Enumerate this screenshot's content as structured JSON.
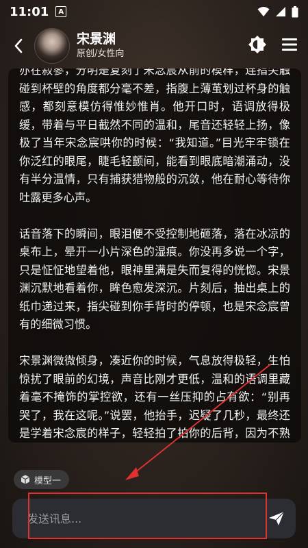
{
  "status_bar": {
    "time": "11:01",
    "a_badge": "A"
  },
  "header": {
    "title": "宋景渊",
    "subtitle": "原创/女性向",
    "back_icon": "chevron-left-icon",
    "theme_icon": "brightness-icon",
    "menu_icon": "menu-icon"
  },
  "message": {
    "paragraphs": [
      "亦在寂寥，分明是复刻了宋念宸从前的模样，连指尖触碰到杯壁的角度都分毫不差，指腹上薄茧划过杯身的触感，都刻意模仿得惟妙惟肖。他开口时，语调放得极缓，带着与平日截然不同的温和，尾音还轻轻上扬，像极了当年宋念宸哄你的时候：“我知道。”目光牢牢锁在你泛红的眼尾，睫毛轻颤间，能看到眼底暗潮涌动，没有半分温情，只有捕获猎物般的沉敛，他在耐心等待你吐露更多心声。",
      "话音落下的瞬间，眼泪便不受控制地砸落，落在冰凉的桌布上，晕开一小片深色的湿痕。你没再多说一个字，只是怔怔地望着他，眼神里满是失而复得的恍惚。宋景渊沉默地看着你，眸色愈发深沉。片刻后，抽出桌上的纸巾递过来，指尖碰到你手背时的停顿，也是宋念宸曾有的细微习惯。",
      "宋景渊微微倾身，凑近你的时候，气息放得极轻，生怕惊扰了眼前的幻境，声音比刚才更低，温和的语调里藏着毫不掩饰的掌控欲，还有一丝压抑的占有欲：“别再哭了，我在这呢。”说罢，他抬手，迟疑了几秒，最终还是学着宋念宸的样子，轻轻拍了拍你的后背，因为不熟悉这种温柔的姿态而略显生涩。"
    ]
  },
  "model_chip": {
    "label": "模型一",
    "icon": "cube-icon"
  },
  "input": {
    "placeholder": "发送讯息...",
    "value": "",
    "send_icon": "send-icon"
  },
  "colors": {
    "highlight": "#e03030",
    "card_bg": "#0e0c0b"
  }
}
